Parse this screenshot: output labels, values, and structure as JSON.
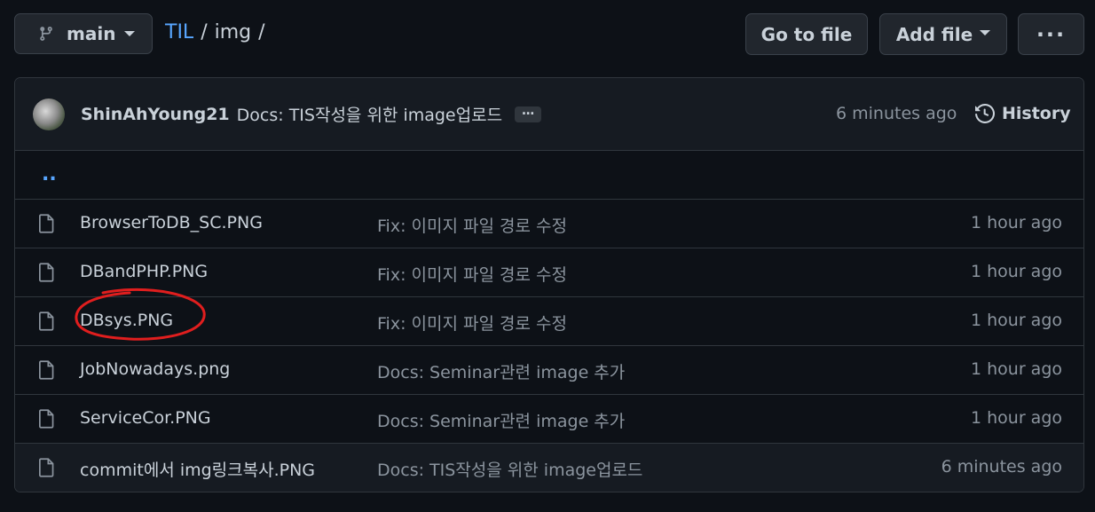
{
  "branch": {
    "name": "main",
    "icon": "git-branch-icon"
  },
  "breadcrumb": {
    "repo": "TIL",
    "sep1": "/",
    "folder": "img",
    "sep2": "/"
  },
  "actions": {
    "go_to_file": "Go to file",
    "add_file": "Add file",
    "more": "···"
  },
  "latest_commit": {
    "author": "ShinAhYoung21",
    "message": "Docs: TIS작성을 위한 image업로드",
    "expand": "…",
    "time": "6 minutes ago",
    "history_label": "History"
  },
  "parent_dir": "..",
  "files": [
    {
      "name": "BrowserToDB_SC.PNG",
      "message": "Fix: 이미지 파일 경로 수정",
      "time": "1 hour ago"
    },
    {
      "name": "DBandPHP.PNG",
      "message": "Fix: 이미지 파일 경로 수정",
      "time": "1 hour ago"
    },
    {
      "name": "DBsys.PNG",
      "message": "Fix: 이미지 파일 경로 수정",
      "time": "1 hour ago"
    },
    {
      "name": "JobNowadays.png",
      "message": "Docs: Seminar관련 image 추가",
      "time": "1 hour ago"
    },
    {
      "name": "ServiceCor.PNG",
      "message": "Docs: Seminar관련 image 추가",
      "time": "1 hour ago"
    },
    {
      "name": "commit에서 img링크복사.PNG",
      "message": "Docs: TIS작성을 위한 image업로드",
      "time": "6 minutes ago"
    }
  ],
  "colors": {
    "background": "#0d1117",
    "link": "#58a6ff",
    "annotation": "#e01e1e"
  }
}
